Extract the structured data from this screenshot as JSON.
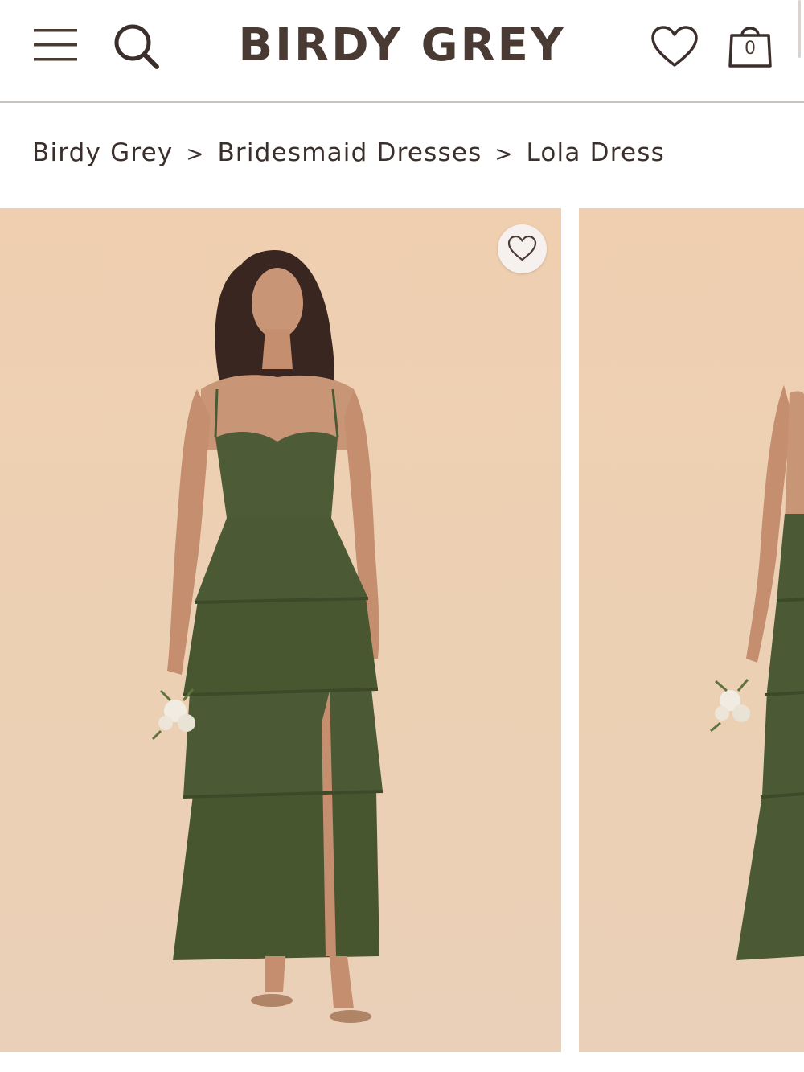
{
  "header": {
    "logo_text": "BIRDY GREY",
    "cart_count": "0",
    "icons": [
      "menu-icon",
      "search-icon",
      "heart-icon",
      "shopping-bag-icon"
    ]
  },
  "breadcrumb": {
    "items": [
      "Birdy Grey",
      "Bridesmaid Dresses",
      "Lola Dress"
    ],
    "separator": ">"
  },
  "gallery": {
    "favorite_icon": "heart-icon",
    "images": [
      {
        "subject": "model wearing tiered dress, front view"
      },
      {
        "subject": "model wearing tiered dress, side view"
      }
    ]
  },
  "colors": {
    "brand_text": "#4a3a34",
    "photo_background": "#ecd0b4",
    "dress": "#4b5a35"
  }
}
